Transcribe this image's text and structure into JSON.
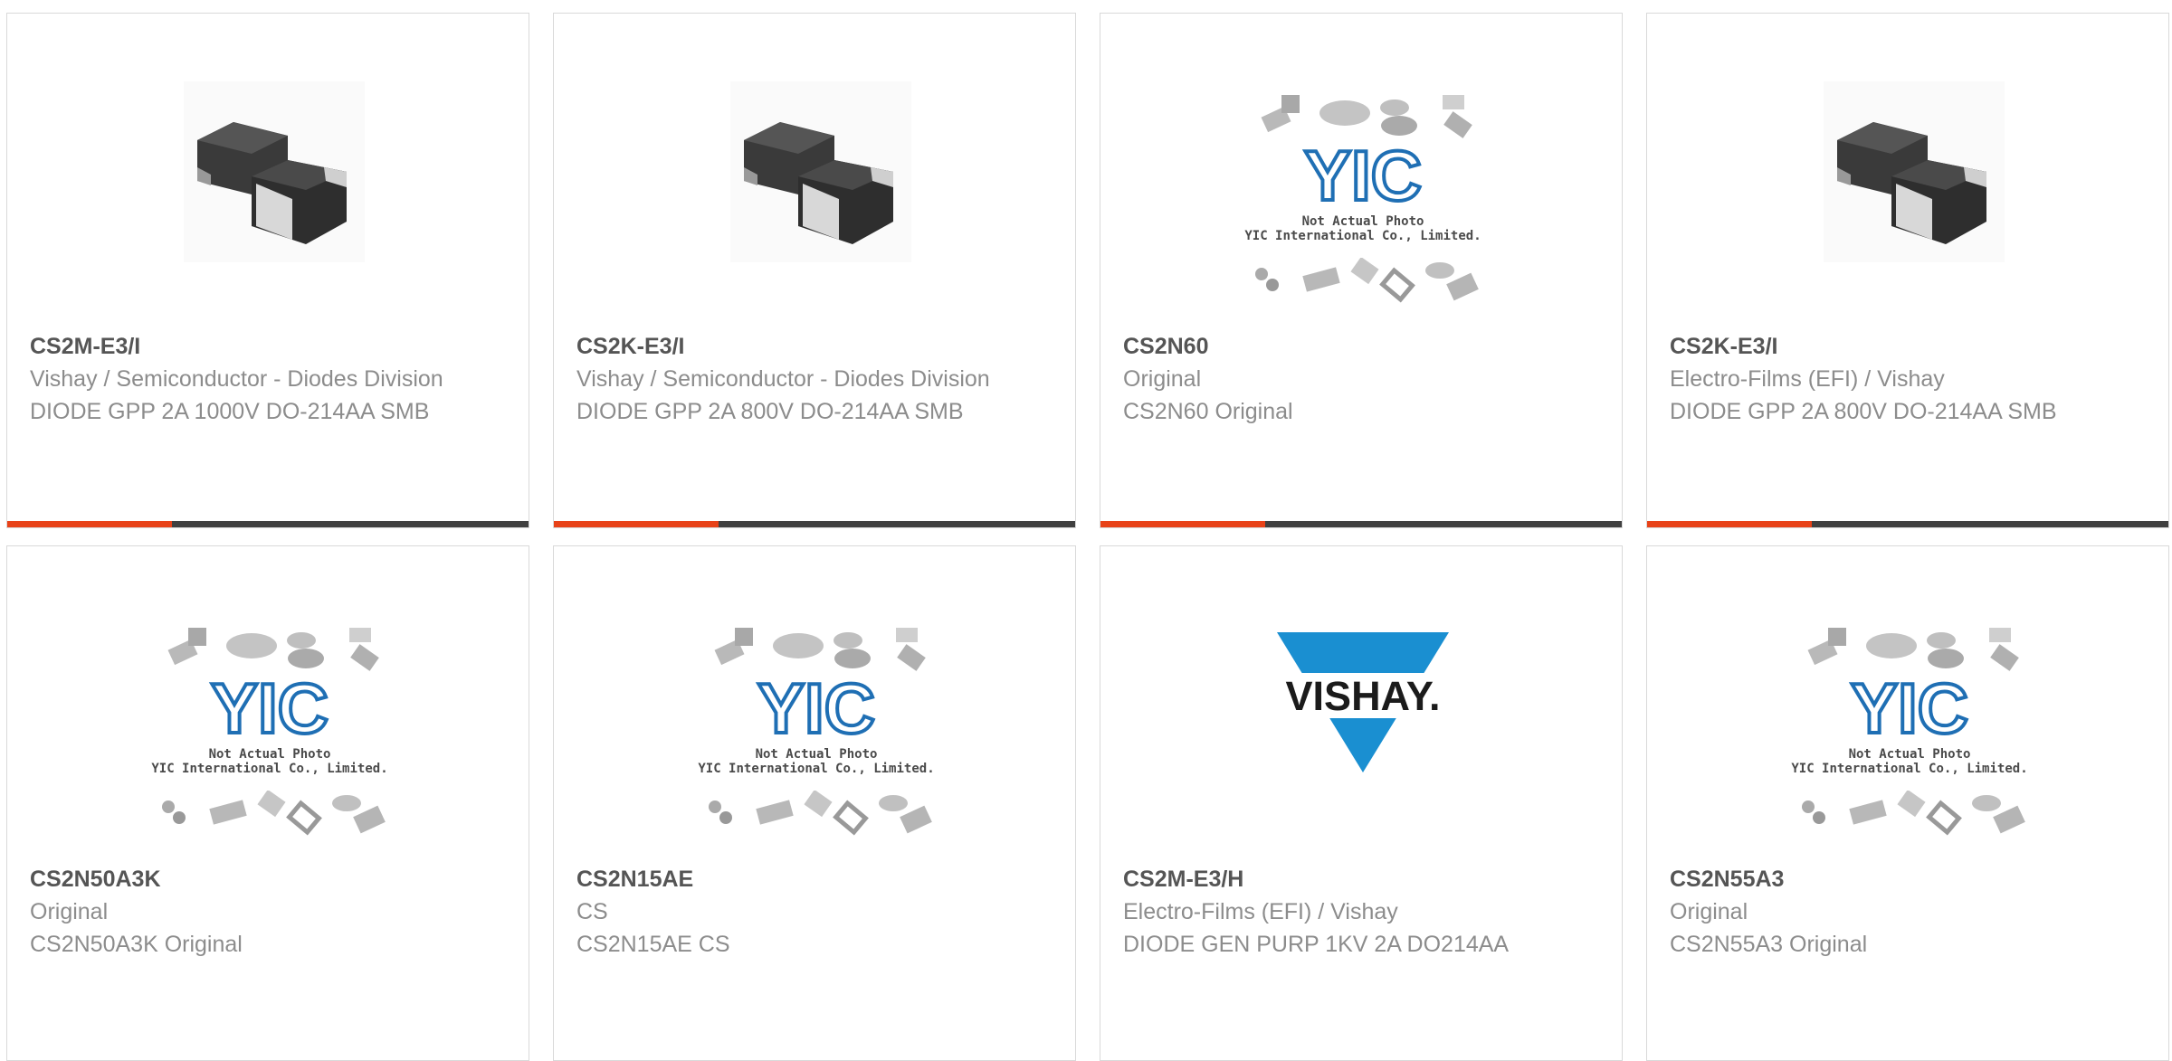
{
  "cards": [
    {
      "part": "CS2M-E3/I",
      "line1": "Vishay / Semiconductor - Diodes Division",
      "line2": "DIODE GPP 2A 1000V DO-214AA SMB",
      "image": "smb-package-photo"
    },
    {
      "part": "CS2K-E3/I",
      "line1": "Vishay / Semiconductor - Diodes Division",
      "line2": "DIODE GPP 2A 800V DO-214AA SMB",
      "image": "smb-package-photo"
    },
    {
      "part": "CS2N60",
      "line1": "Original",
      "line2": "CS2N60 Original",
      "image": "yic-placeholder",
      "placeholder_line1": "Not Actual Photo",
      "placeholder_line2": "YIC International Co., Limited."
    },
    {
      "part": "CS2K-E3/I",
      "line1": "Electro-Films (EFI) / Vishay",
      "line2": "DIODE GPP 2A 800V DO-214AA SMB",
      "image": "smb-package-photo"
    },
    {
      "part": "CS2N50A3K",
      "line1": "Original",
      "line2": "CS2N50A3K Original",
      "image": "yic-placeholder",
      "placeholder_line1": "Not Actual Photo",
      "placeholder_line2": "YIC International Co., Limited."
    },
    {
      "part": "CS2N15AE",
      "line1": "CS",
      "line2": "CS2N15AE CS",
      "image": "yic-placeholder",
      "placeholder_line1": "Not Actual Photo",
      "placeholder_line2": "YIC International Co., Limited."
    },
    {
      "part": "CS2M-E3/H",
      "line1": "Electro-Films (EFI) / Vishay",
      "line2": "DIODE GEN PURP 1KV 2A DO214AA",
      "image": "vishay-logo",
      "logo_text": "VISHAY."
    },
    {
      "part": "CS2N55A3",
      "line1": "Original",
      "line2": "CS2N55A3 Original",
      "image": "yic-placeholder",
      "placeholder_line1": "Not Actual Photo",
      "placeholder_line2": "YIC International Co., Limited."
    }
  ],
  "colors": {
    "accent": "#e84218",
    "bar": "#404040",
    "vishay_blue": "#1a8fd1",
    "yic_blue": "#1f6fb4"
  }
}
